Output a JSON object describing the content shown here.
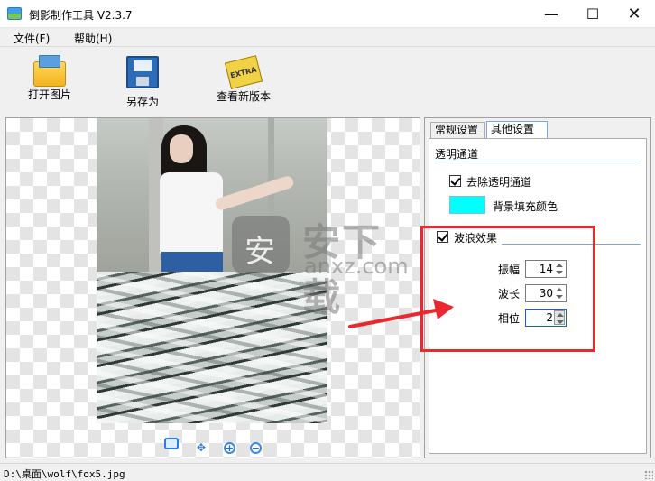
{
  "window": {
    "title": "倒影制作工具 V2.3.7",
    "minimize_glyph": "—",
    "maximize_glyph": "☐",
    "close_glyph": "✕"
  },
  "menu": {
    "file": "文件(F)",
    "help": "帮助(H)"
  },
  "toolbar": {
    "open_label": "打开图片",
    "save_as_label": "另存为",
    "check_version_label": "查看新版本"
  },
  "watermark": {
    "text": "安下载",
    "sub": "anxz.com"
  },
  "zoom": {
    "in_glyph": "+",
    "out_glyph": "−"
  },
  "settings": {
    "tabs": [
      {
        "label": "常规设置",
        "active": false
      },
      {
        "label": "其他设置",
        "active": true
      }
    ],
    "transparency": {
      "group_title": "透明通道",
      "remove_alpha_label": "去除透明通道",
      "remove_alpha_checked": true,
      "fill_color_label": "背景填充颜色",
      "fill_color": "#00ffff"
    },
    "wave": {
      "label": "波浪效果",
      "checked": true,
      "amplitude_label": "振幅",
      "amplitude_value": "14",
      "wavelength_label": "波长",
      "wavelength_value": "30",
      "phase_label": "相位",
      "phase_value": "2"
    }
  },
  "status": {
    "path": "D:\\桌面\\wolf\\fox5.jpg"
  },
  "colors": {
    "highlight": "#e8292f",
    "accent": "#2c7de0"
  }
}
